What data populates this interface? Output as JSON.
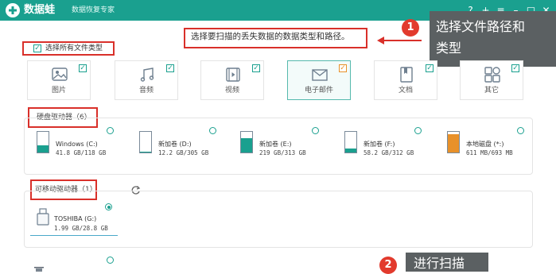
{
  "app": {
    "title": "数据蛙",
    "subtitle": "数据恢复专家"
  },
  "window_controls": [
    "?",
    "+",
    "≡",
    "–",
    "□",
    "✕"
  ],
  "instruction": "选择要扫描的丢失数据的数据类型和路径。",
  "select_all": {
    "label": "选择所有文件类型",
    "checked": true
  },
  "file_types": [
    {
      "label": "图片",
      "icon": "image-icon",
      "checked": true
    },
    {
      "label": "音频",
      "icon": "music-icon",
      "checked": true
    },
    {
      "label": "视频",
      "icon": "video-icon",
      "checked": true
    },
    {
      "label": "电子邮件",
      "icon": "email-icon",
      "checked": true
    },
    {
      "label": "文档",
      "icon": "document-icon",
      "checked": true
    },
    {
      "label": "其它",
      "icon": "other-icon",
      "checked": true
    }
  ],
  "hard_drives": {
    "header": "硬盘驱动器（6）",
    "items": [
      {
        "name": "Windows (C:)",
        "size": "41.8 GB/118 GB",
        "used_fraction": 0.35,
        "color": "#1aa08f"
      },
      {
        "name": "新加卷 (D:)",
        "size": "12.2 GB/305 GB",
        "used_fraction": 0.04,
        "color": "#1aa08f"
      },
      {
        "name": "新加卷 (E:)",
        "size": "219 GB/313 GB",
        "used_fraction": 0.7,
        "color": "#1aa08f"
      },
      {
        "name": "新加卷 (F:)",
        "size": "58.2 GB/312 GB",
        "used_fraction": 0.19,
        "color": "#1aa08f"
      },
      {
        "name": "本地磁盘 (*:)",
        "size": "611 MB/693 MB",
        "used_fraction": 0.88,
        "color": "#e8912a"
      }
    ]
  },
  "removable": {
    "header": "可移动驱动器（1）",
    "items": [
      {
        "name": "TOSHIBA (G:)",
        "size": "1.99 GB/28.8 GB",
        "selected": true
      }
    ]
  },
  "callouts": [
    {
      "number": "1",
      "text_line1": "选择文件路径和",
      "text_line2": "类型"
    },
    {
      "number": "2",
      "text": "进行扫描"
    }
  ],
  "colors": {
    "accent": "#1aa08f",
    "highlight": "#d9302a",
    "callout_bg": "#5b6062",
    "badge": "#e23a2d"
  }
}
